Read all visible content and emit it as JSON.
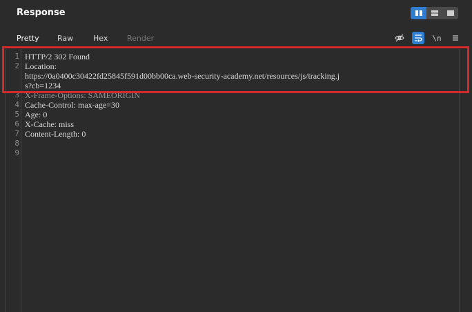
{
  "panel": {
    "title": "Response"
  },
  "layout_toggle": {
    "options": [
      "split-view",
      "rows-view",
      "single-view"
    ],
    "active_index": 0
  },
  "tabs": [
    {
      "label": "Pretty",
      "active": true
    },
    {
      "label": "Raw",
      "active": false
    },
    {
      "label": "Hex",
      "active": false
    },
    {
      "label": "Render",
      "active": false,
      "disabled": true
    }
  ],
  "tools": [
    {
      "name": "hide-eye-icon",
      "label": ""
    },
    {
      "name": "word-wrap-icon",
      "label": "",
      "active": true
    },
    {
      "name": "newline-toggle",
      "label": "\\n"
    },
    {
      "name": "menu-icon",
      "label": ""
    }
  ],
  "response_lines": [
    {
      "num": "1",
      "text": "HTTP/2 302 Found"
    },
    {
      "num": "2",
      "text": "Location:"
    },
    {
      "num": "",
      "text": "https://0a0400c30422fd25845f591d00bb00ca.web-security-academy.net/resources/js/tracking.j"
    },
    {
      "num": "",
      "text": "s?cb=1234"
    },
    {
      "num": "3",
      "text": "X-Frame-Options: SAMEORIGIN"
    },
    {
      "num": "4",
      "text": "Cache-Control: max-age=30"
    },
    {
      "num": "5",
      "text": "Age: 0"
    },
    {
      "num": "6",
      "text": "X-Cache: miss"
    },
    {
      "num": "7",
      "text": "Content-Length: 0"
    },
    {
      "num": "8",
      "text": ""
    },
    {
      "num": "9",
      "text": ""
    }
  ],
  "colors": {
    "background": "#2b2b2b",
    "accent": "#2f7dd0",
    "highlight": "#d42a2a",
    "tab_underline": "#d9534f"
  }
}
